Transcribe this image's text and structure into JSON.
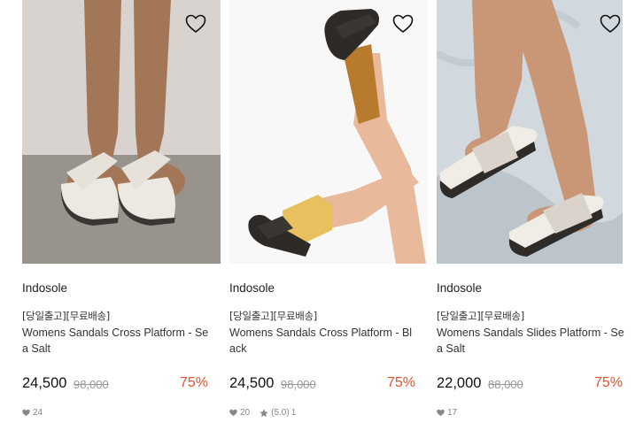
{
  "products": [
    {
      "brand": "Indosole",
      "tag": "[당일출고][무료배송]",
      "name": "Womens Sandals Cross Platform - Sea Salt",
      "price": "24,500",
      "original_price": "98,000",
      "discount": "75%",
      "likes": "24",
      "rating": "",
      "reviews": ""
    },
    {
      "brand": "Indosole",
      "tag": "[당일출고][무료배송]",
      "name": "Womens Sandals Cross Platform - Black",
      "price": "24,500",
      "original_price": "98,000",
      "discount": "75%",
      "likes": "20",
      "rating": "(5.0)",
      "reviews": "1"
    },
    {
      "brand": "Indosole",
      "tag": "[당일출고][무료배송]",
      "name": "Womens Sandals Slides Platform - Sea Salt",
      "price": "22,000",
      "original_price": "88,000",
      "discount": "75%",
      "likes": "17",
      "rating": "",
      "reviews": ""
    }
  ],
  "colors": {
    "discount": "#e8502e",
    "heart": "#111111",
    "muted": "#888888"
  },
  "icons": {
    "wishlist": "heart-outline-icon",
    "likes": "heart-filled-icon",
    "rating": "star-icon"
  }
}
